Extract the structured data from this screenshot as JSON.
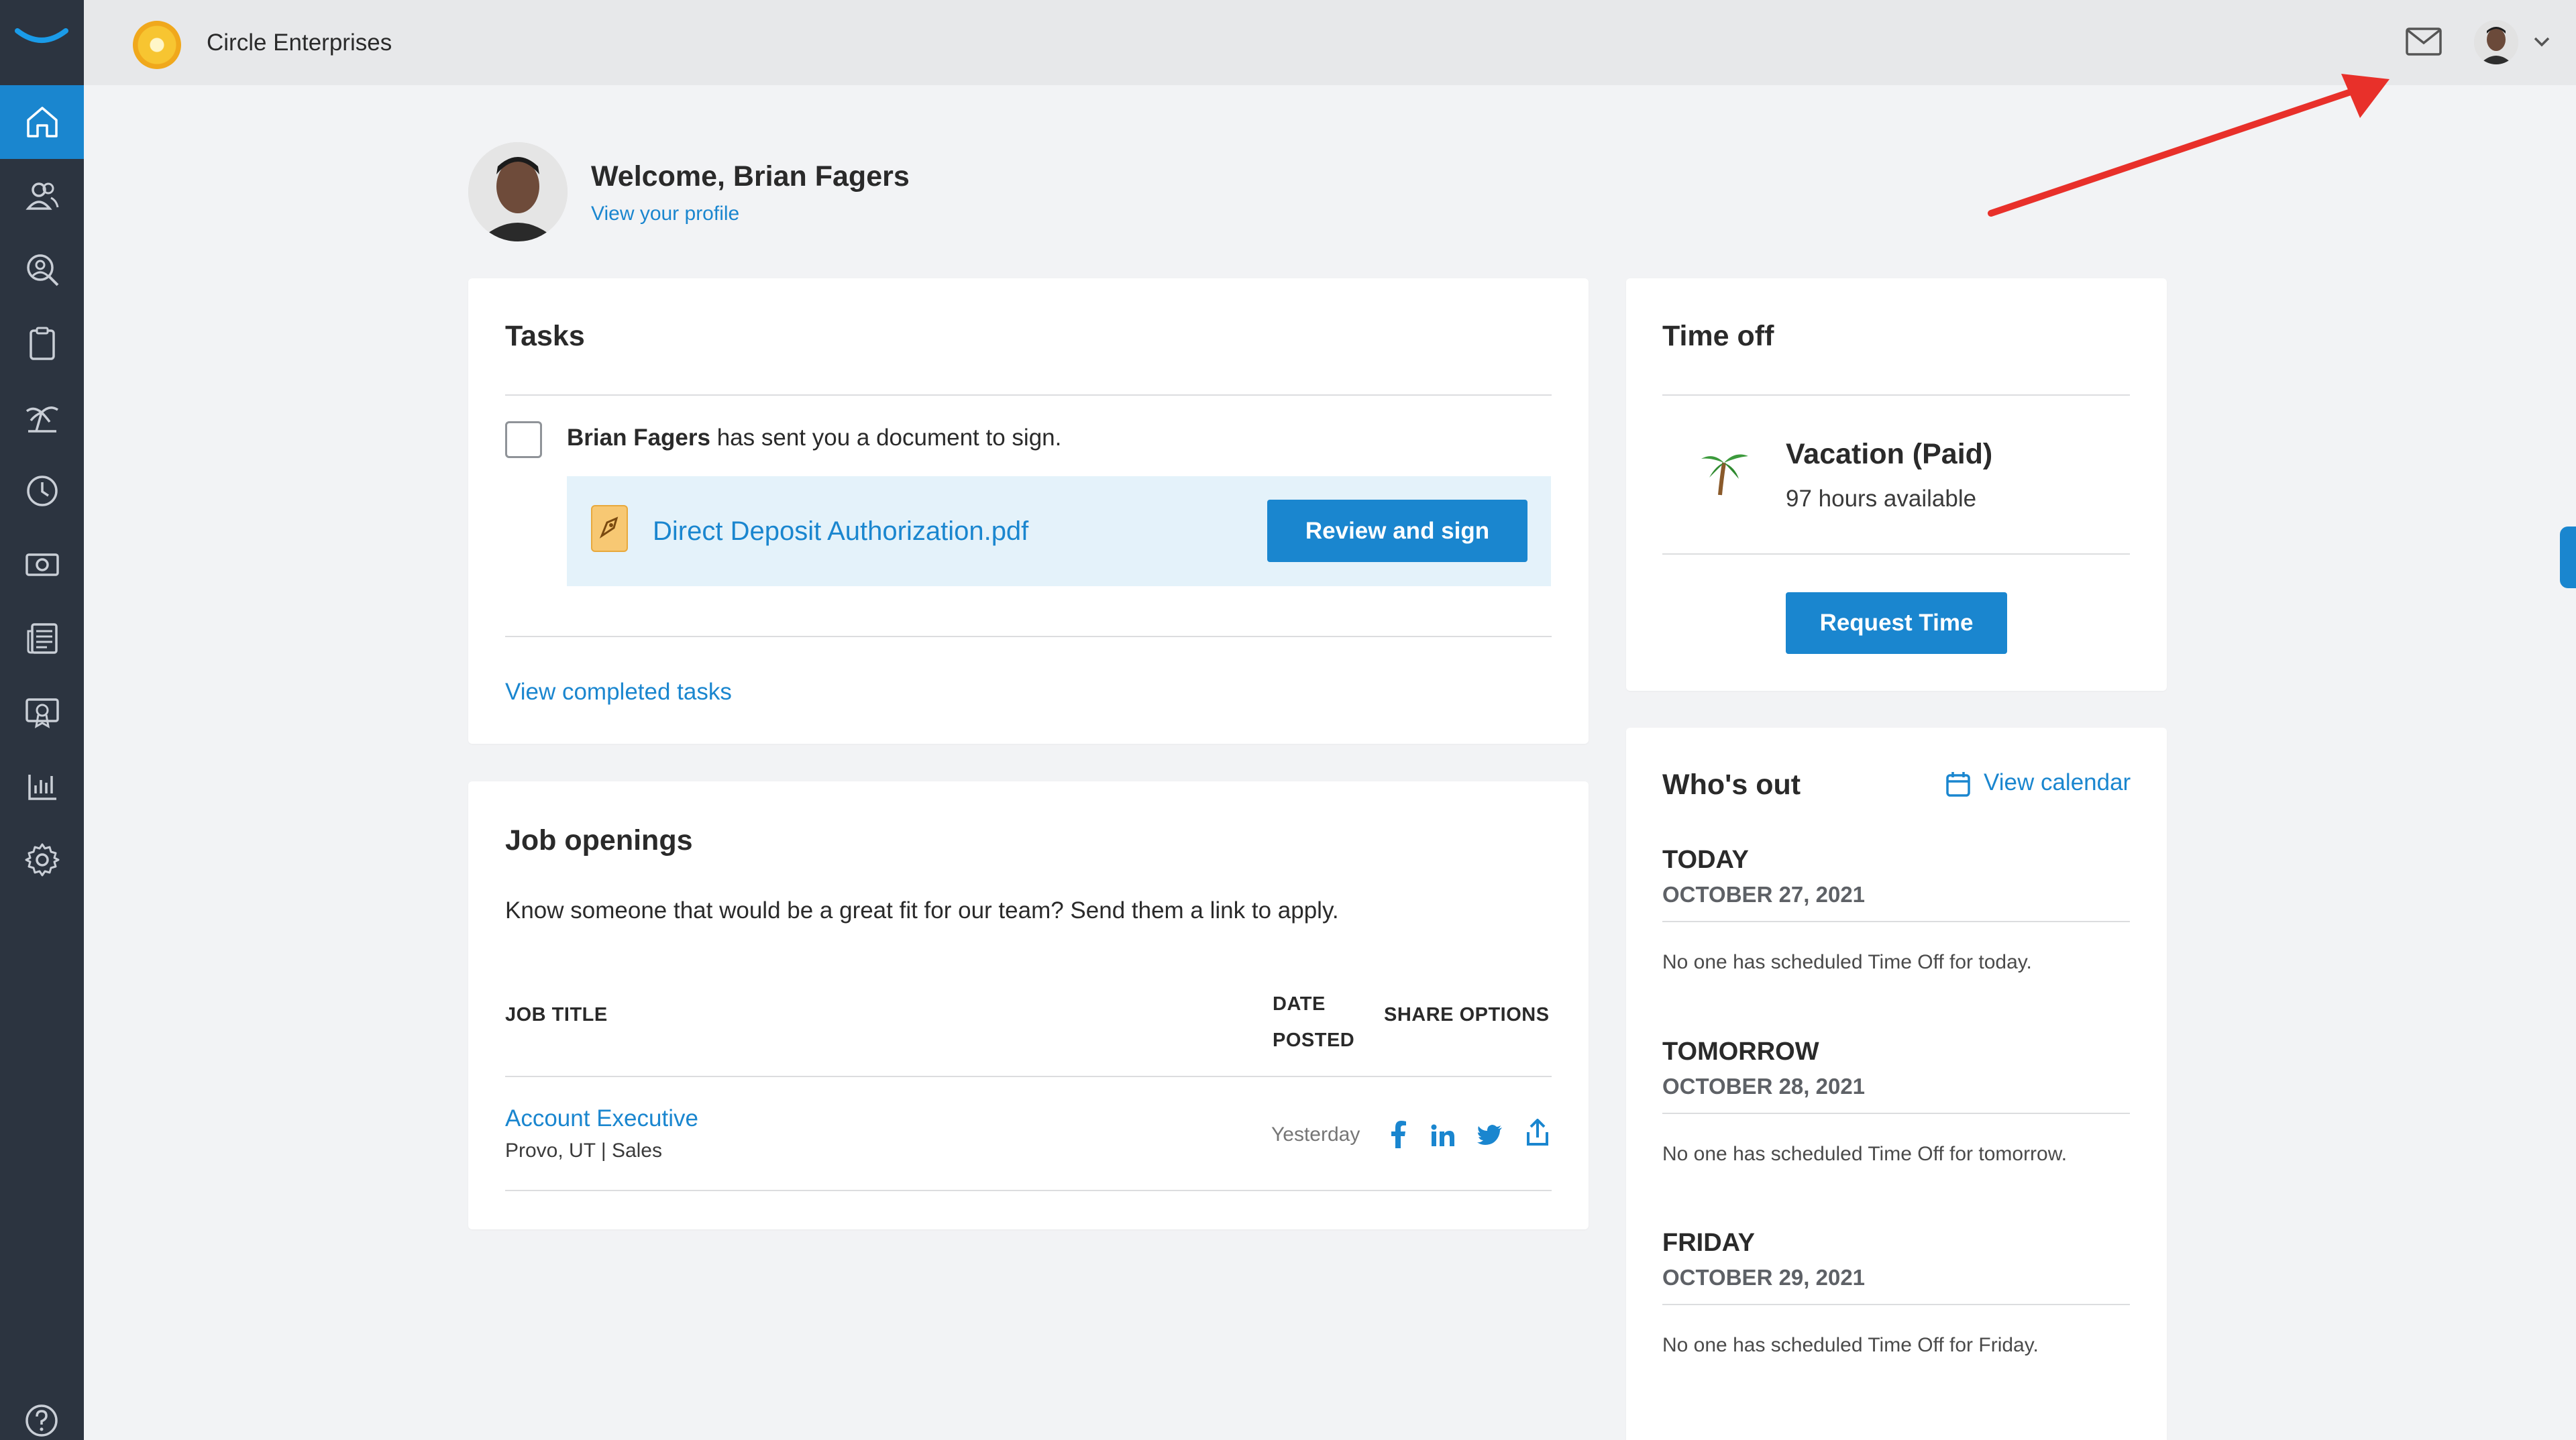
{
  "header": {
    "company_name": "Circle Enterprises",
    "icons": [
      "brand-logo",
      "company-logo",
      "mail-icon",
      "user-avatar",
      "chevron-down-icon"
    ]
  },
  "sidebar": {
    "items": [
      {
        "icon": "home-icon",
        "active": true
      },
      {
        "icon": "people-icon"
      },
      {
        "icon": "person-search-icon"
      },
      {
        "icon": "clipboard-icon"
      },
      {
        "icon": "palm-tree-icon"
      },
      {
        "icon": "clock-icon"
      },
      {
        "icon": "money-icon"
      },
      {
        "icon": "newspaper-icon"
      },
      {
        "icon": "certificate-icon"
      },
      {
        "icon": "bar-chart-icon"
      },
      {
        "icon": "gear-icon"
      }
    ],
    "help_icon": "help-icon"
  },
  "welcome": {
    "title": "Welcome, Brian Fagers",
    "profile_link": "View your profile"
  },
  "tasks": {
    "title": "Tasks",
    "task_sender": "Brian Fagers",
    "task_text": " has sent you a document to sign.",
    "document_name": "Direct Deposit Authorization.pdf",
    "review_button": "Review and sign",
    "view_completed": "View completed tasks"
  },
  "jobs": {
    "title": "Job openings",
    "description": "Know someone that would be a great fit for our team? Send them a link to apply.",
    "columns": {
      "job_title": "JOB TITLE",
      "date_posted_1": "DATE",
      "date_posted_2": "POSTED",
      "share": "SHARE OPTIONS"
    },
    "rows": [
      {
        "title": "Account Executive",
        "location": "Provo, UT | Sales",
        "date": "Yesterday"
      }
    ],
    "share_icons": [
      "facebook-icon",
      "linkedin-icon",
      "twitter-icon",
      "share-icon"
    ]
  },
  "time_off": {
    "title": "Time off",
    "policy": "Vacation (Paid)",
    "hours": "97 hours available",
    "request_button": "Request Time"
  },
  "whos_out": {
    "title": "Who's out",
    "calendar_link": "View calendar",
    "days": [
      {
        "label": "TODAY",
        "date": "OCTOBER 27, 2021",
        "note": "No one has scheduled Time Off for today."
      },
      {
        "label": "TOMORROW",
        "date": "OCTOBER 28, 2021",
        "note": "No one has scheduled Time Off for tomorrow."
      },
      {
        "label": "FRIDAY",
        "date": "OCTOBER 29, 2021",
        "note": "No one has scheduled Time Off for Friday."
      }
    ]
  },
  "colors": {
    "accent": "#1a86cf",
    "sidebar": "#2c3440",
    "annotation_arrow": "#e8302a",
    "background": "#f2f3f5"
  }
}
